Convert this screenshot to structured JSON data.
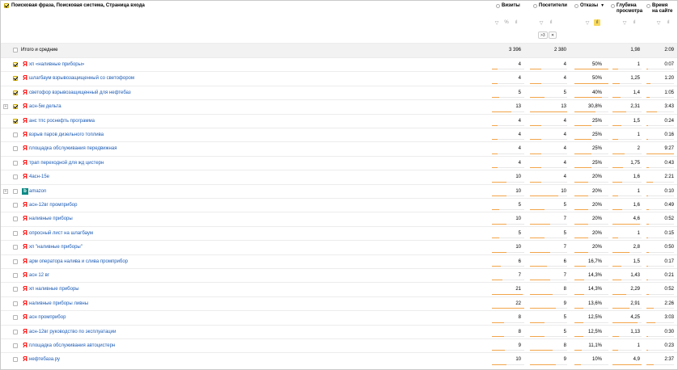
{
  "header": {
    "title": "Поисковая фраза, Поисковая система, Страница входа",
    "columns": [
      {
        "key": "visits",
        "label": "Визиты",
        "label2": ""
      },
      {
        "key": "visitors",
        "label": "Посетители",
        "label2": ""
      },
      {
        "key": "bounce",
        "label": "Отказы",
        "label2": "",
        "sort": "▼"
      },
      {
        "key": "depth",
        "label": "Глубина",
        "label2": "просмотра"
      },
      {
        "key": "time",
        "label": "Время",
        "label2": "на сайте"
      }
    ],
    "tools": {
      "filter": "▽",
      "percent": "%",
      "chart": "ıl"
    },
    "chip": {
      "label": ">3",
      "close": "✕"
    }
  },
  "total": {
    "label": "Итого и средние",
    "visits": "3 396",
    "visitors": "2 380",
    "bounce": "",
    "depth": "1,98",
    "time": "2:09"
  },
  "rows": [
    {
      "checked": true,
      "expand": false,
      "engine": "ya",
      "phrase": "хп «наливные приборы»",
      "visits": "4",
      "visitors": "4",
      "bounce": "50%",
      "depth": "1",
      "time": "0:07",
      "bounce_pct": 50
    },
    {
      "checked": true,
      "expand": false,
      "engine": "ya",
      "phrase": "шлагбаум взрывозащищенный со светофором",
      "visits": "4",
      "visitors": "4",
      "bounce": "50%",
      "depth": "1,25",
      "time": "1:20",
      "bounce_pct": 50
    },
    {
      "checked": true,
      "expand": false,
      "engine": "ya",
      "phrase": "светофор взрывозащищенный для нефтебаз",
      "visits": "5",
      "visitors": "5",
      "bounce": "40%",
      "depth": "1,4",
      "time": "1:05",
      "bounce_pct": 40
    },
    {
      "checked": true,
      "expand": true,
      "engine": "ya",
      "phrase": "асн-5м дельта",
      "visits": "13",
      "visitors": "13",
      "bounce": "30,8%",
      "depth": "2,31",
      "time": "3:43",
      "bounce_pct": 30.8
    },
    {
      "checked": true,
      "expand": false,
      "engine": "ya",
      "phrase": "анс тпс роснефть программа",
      "visits": "4",
      "visitors": "4",
      "bounce": "25%",
      "depth": "1,5",
      "time": "0:24",
      "bounce_pct": 25
    },
    {
      "checked": false,
      "expand": false,
      "engine": "ya",
      "phrase": "взрыв паров дизельного топлива",
      "visits": "4",
      "visitors": "4",
      "bounce": "25%",
      "depth": "1",
      "time": "0:16",
      "bounce_pct": 25
    },
    {
      "checked": false,
      "expand": false,
      "engine": "ya",
      "phrase": "площадка обслуживания передвижная",
      "visits": "4",
      "visitors": "4",
      "bounce": "25%",
      "depth": "2",
      "time": "9:27",
      "bounce_pct": 25
    },
    {
      "checked": false,
      "expand": false,
      "engine": "ya",
      "phrase": "трап переходной для жд цистерн",
      "visits": "4",
      "visitors": "4",
      "bounce": "25%",
      "depth": "1,75",
      "time": "0:43",
      "bounce_pct": 25
    },
    {
      "checked": false,
      "expand": false,
      "engine": "ya",
      "phrase": "4асн-15е",
      "visits": "10",
      "visitors": "4",
      "bounce": "20%",
      "depth": "1,6",
      "time": "2:21",
      "bounce_pct": 20
    },
    {
      "checked": false,
      "expand": true,
      "engine": "bing",
      "phrase": "amazon",
      "visits": "10",
      "visitors": "10",
      "bounce": "20%",
      "depth": "1",
      "time": "0:10",
      "bounce_pct": 20
    },
    {
      "checked": false,
      "expand": false,
      "engine": "ya",
      "phrase": "асн-12вг промприбор",
      "visits": "5",
      "visitors": "5",
      "bounce": "20%",
      "depth": "1,6",
      "time": "0:49",
      "bounce_pct": 20
    },
    {
      "checked": false,
      "expand": false,
      "engine": "ya",
      "phrase": "наливные приборы",
      "visits": "10",
      "visitors": "7",
      "bounce": "20%",
      "depth": "4,6",
      "time": "0:52",
      "bounce_pct": 20
    },
    {
      "checked": false,
      "expand": false,
      "engine": "ya",
      "phrase": "опросный лист на шлагбаум",
      "visits": "5",
      "visitors": "5",
      "bounce": "20%",
      "depth": "1",
      "time": "0:15",
      "bounce_pct": 20
    },
    {
      "checked": false,
      "expand": false,
      "engine": "ya",
      "phrase": "хп \"наливные приборы\"",
      "visits": "10",
      "visitors": "7",
      "bounce": "20%",
      "depth": "2,8",
      "time": "0:50",
      "bounce_pct": 20
    },
    {
      "checked": false,
      "expand": false,
      "engine": "ya",
      "phrase": "арм оператора налива и слива промприбор",
      "visits": "6",
      "visitors": "6",
      "bounce": "16,7%",
      "depth": "1,5",
      "time": "0:17",
      "bounce_pct": 16.7
    },
    {
      "checked": false,
      "expand": false,
      "engine": "ya",
      "phrase": "асн 12 вг",
      "visits": "7",
      "visitors": "7",
      "bounce": "14,3%",
      "depth": "1,43",
      "time": "0:21",
      "bounce_pct": 14.3
    },
    {
      "checked": false,
      "expand": false,
      "engine": "ya",
      "phrase": "хп наливные приборы",
      "visits": "21",
      "visitors": "8",
      "bounce": "14,3%",
      "depth": "2,29",
      "time": "0:52",
      "bounce_pct": 14.3
    },
    {
      "checked": false,
      "expand": false,
      "engine": "ya",
      "phrase": "наливные приборы ливны",
      "visits": "22",
      "visitors": "9",
      "bounce": "13,6%",
      "depth": "2,91",
      "time": "2:26",
      "bounce_pct": 13.6
    },
    {
      "checked": false,
      "expand": false,
      "engine": "ya",
      "phrase": "асн промприбор",
      "visits": "8",
      "visitors": "5",
      "bounce": "12,5%",
      "depth": "4,25",
      "time": "3:03",
      "bounce_pct": 12.5
    },
    {
      "checked": false,
      "expand": false,
      "engine": "ya",
      "phrase": "асн-12вг руководство по эксплуатации",
      "visits": "8",
      "visitors": "5",
      "bounce": "12,5%",
      "depth": "1,13",
      "time": "0:30",
      "bounce_pct": 12.5
    },
    {
      "checked": false,
      "expand": false,
      "engine": "ya",
      "phrase": "площадка обслуживания автоцистерн",
      "visits": "9",
      "visitors": "8",
      "bounce": "11,1%",
      "depth": "1",
      "time": "0:23",
      "bounce_pct": 11.1
    },
    {
      "checked": false,
      "expand": false,
      "engine": "ya",
      "phrase": "нефтебаза.ру",
      "visits": "10",
      "visitors": "9",
      "bounce": "10%",
      "depth": "4,9",
      "time": "2:37",
      "bounce_pct": 10
    }
  ],
  "colors": {
    "link": "#1a5bb5",
    "bar": "#f2a54a",
    "highlight": "#f7d85a",
    "yandex": "#ff0000"
  }
}
